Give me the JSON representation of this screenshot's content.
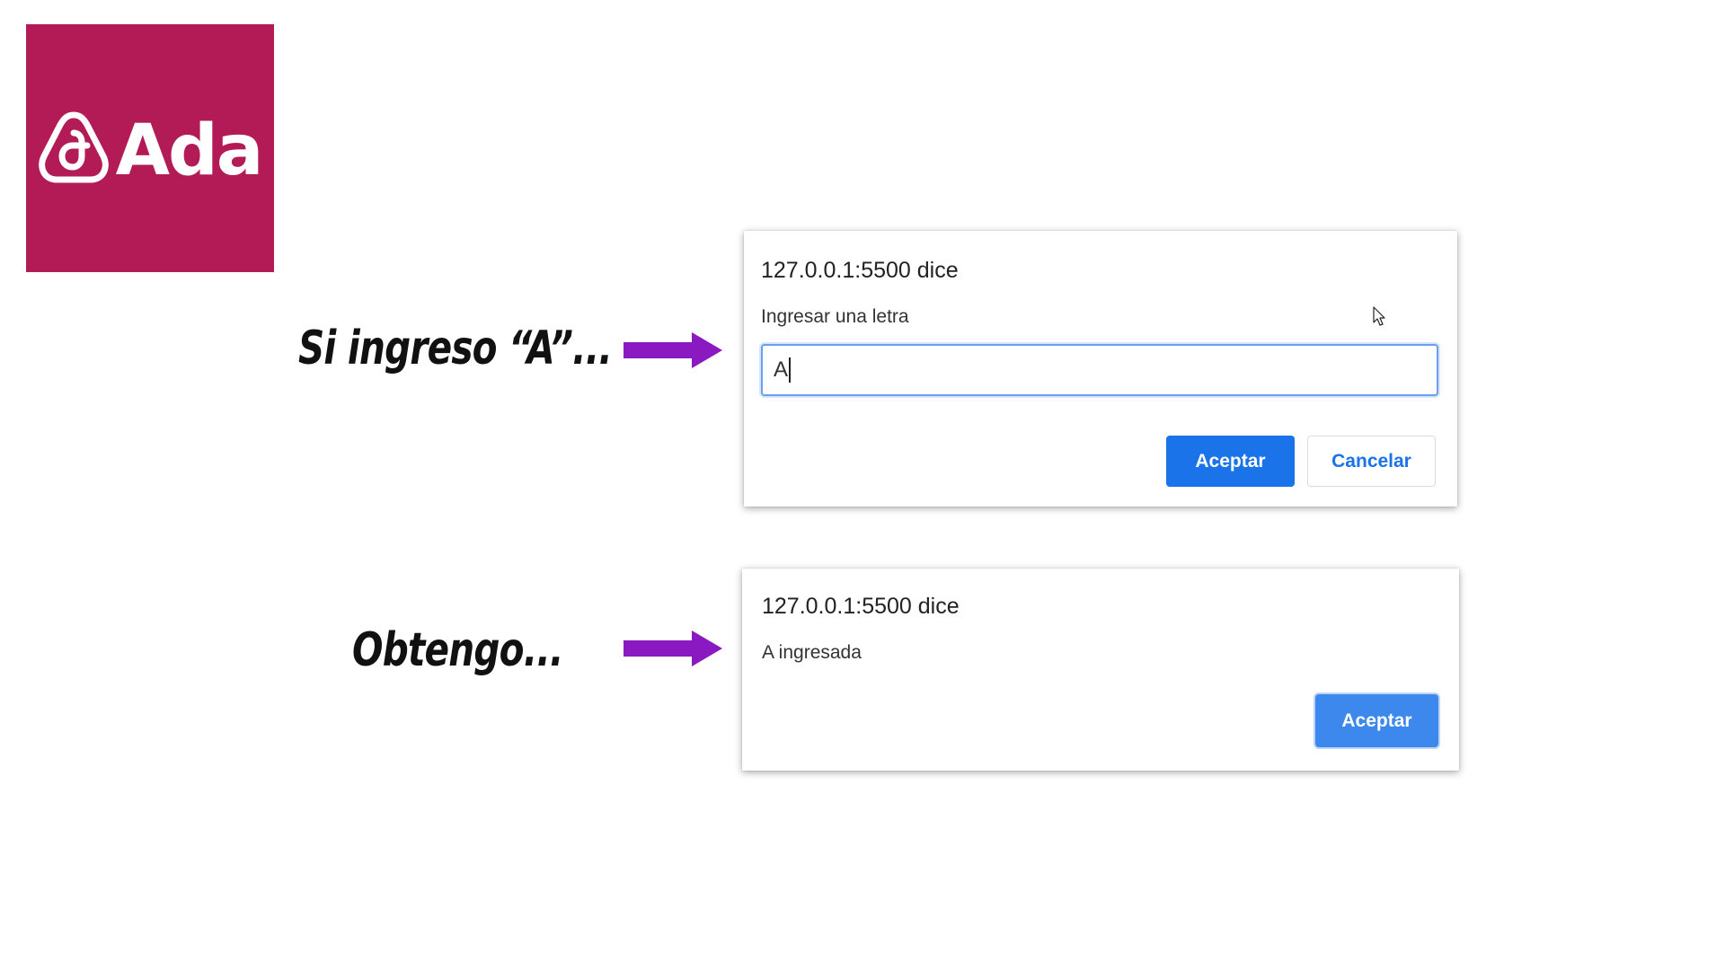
{
  "logo": {
    "text": "Ada",
    "background_color": "#b31b57",
    "icon": "ada-logo-icon"
  },
  "captions": {
    "first": "Si ingreso “A”...",
    "second": "Obtengo..."
  },
  "arrow_color": "#8b19c2",
  "prompt_dialog": {
    "title": "127.0.0.1:5500 dice",
    "message": "Ingresar una letra",
    "input_value": "A",
    "accept_label": "Aceptar",
    "cancel_label": "Cancelar"
  },
  "alert_dialog": {
    "title": "127.0.0.1:5500 dice",
    "message": "A ingresada",
    "accept_label": "Aceptar"
  },
  "colors": {
    "button_blue": "#1a73e8"
  }
}
